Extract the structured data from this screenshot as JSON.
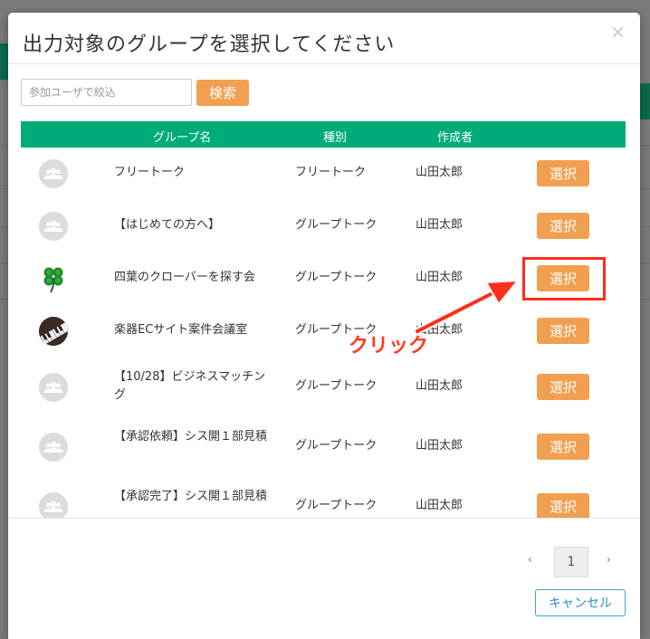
{
  "modal": {
    "title": "出力対象のグループを選択してください",
    "close_glyph": "×"
  },
  "search": {
    "placeholder": "参加ユーザで絞込",
    "value": "",
    "button_label": "検索"
  },
  "table": {
    "headers": {
      "name": "グループ名",
      "type": "種別",
      "creator": "作成者"
    },
    "select_label": "選択",
    "rows": [
      {
        "avatar": "people-icon",
        "name": "フリートーク",
        "type": "フリートーク",
        "creator": "山田太郎"
      },
      {
        "avatar": "people-icon",
        "name": "【はじめての方へ】",
        "type": "グループトーク",
        "creator": "山田太郎"
      },
      {
        "avatar": "clover-icon",
        "name": "四葉のクローバーを探す会",
        "type": "グループトーク",
        "creator": "山田太郎"
      },
      {
        "avatar": "piano-icon",
        "name": "楽器ECサイト案件会議室",
        "type": "グループトーク",
        "creator": "山田太郎"
      },
      {
        "avatar": "people-icon",
        "name": "【10/28】ビジネスマッチング",
        "type": "グループトーク",
        "creator": "山田太郎"
      },
      {
        "avatar": "people-icon",
        "name": "【承認依頼】シス開１部見積",
        "type": "グループトーク",
        "creator": "山田太郎"
      },
      {
        "avatar": "people-icon",
        "name": "【承認完了】シス開１部見積",
        "type": "グループトーク",
        "creator": "山田太郎"
      }
    ]
  },
  "pagination": {
    "prev": "‹",
    "current": "1",
    "next": "›"
  },
  "footer": {
    "cancel_label": "キャンセル"
  },
  "annotation": {
    "text": "クリック",
    "color": "#ff2d1a"
  },
  "colors": {
    "header_green": "#00ab7a",
    "button_orange": "#f0a050",
    "cancel_blue": "#3aa3d9"
  }
}
